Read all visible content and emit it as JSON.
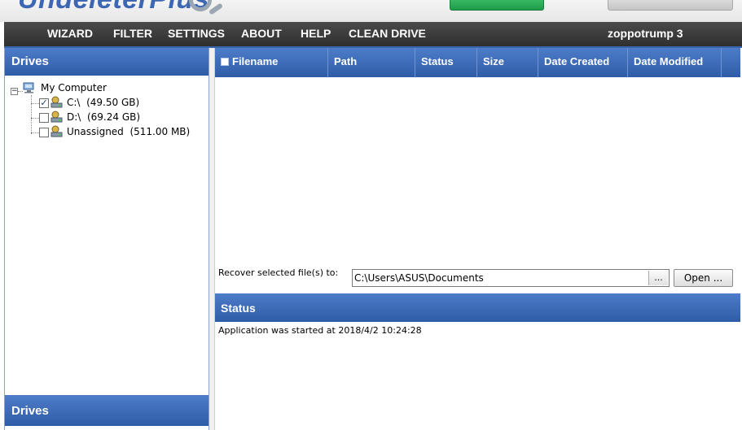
{
  "app": {
    "logo_text": "UndeleterPlus"
  },
  "menu": {
    "items": [
      "WIZARD",
      "FILTER",
      "SETTINGS",
      "ABOUT",
      "HELP",
      "CLEAN DRIVE"
    ],
    "user": "zoppotrump 3"
  },
  "drives_panel": {
    "title": "Drives",
    "footer_title": "Drives",
    "root_label": "My Computer",
    "root_icon": "computer-icon",
    "drives": [
      {
        "name": "C:\\",
        "size": "(49.50 GB)",
        "checked": true
      },
      {
        "name": "D:\\",
        "size": "(69.24 GB)",
        "checked": false
      },
      {
        "name": "Unassigned",
        "size": "(511.00 MB)",
        "checked": false
      }
    ]
  },
  "file_table": {
    "columns": [
      "Filename",
      "Path",
      "Status",
      "Size",
      "Date Created",
      "Date Modified"
    ]
  },
  "recover": {
    "label": "Recover selected file(s) to:",
    "path": "C:\\Users\\ASUS\\Documents",
    "browse_label": "...",
    "open_label": "Open ..."
  },
  "status": {
    "title": "Status",
    "message": "Application was started at 2018/4/2 10:24:28"
  },
  "colors": {
    "accent": "#3a66b0",
    "menu_bg": "#3a3a3a"
  }
}
